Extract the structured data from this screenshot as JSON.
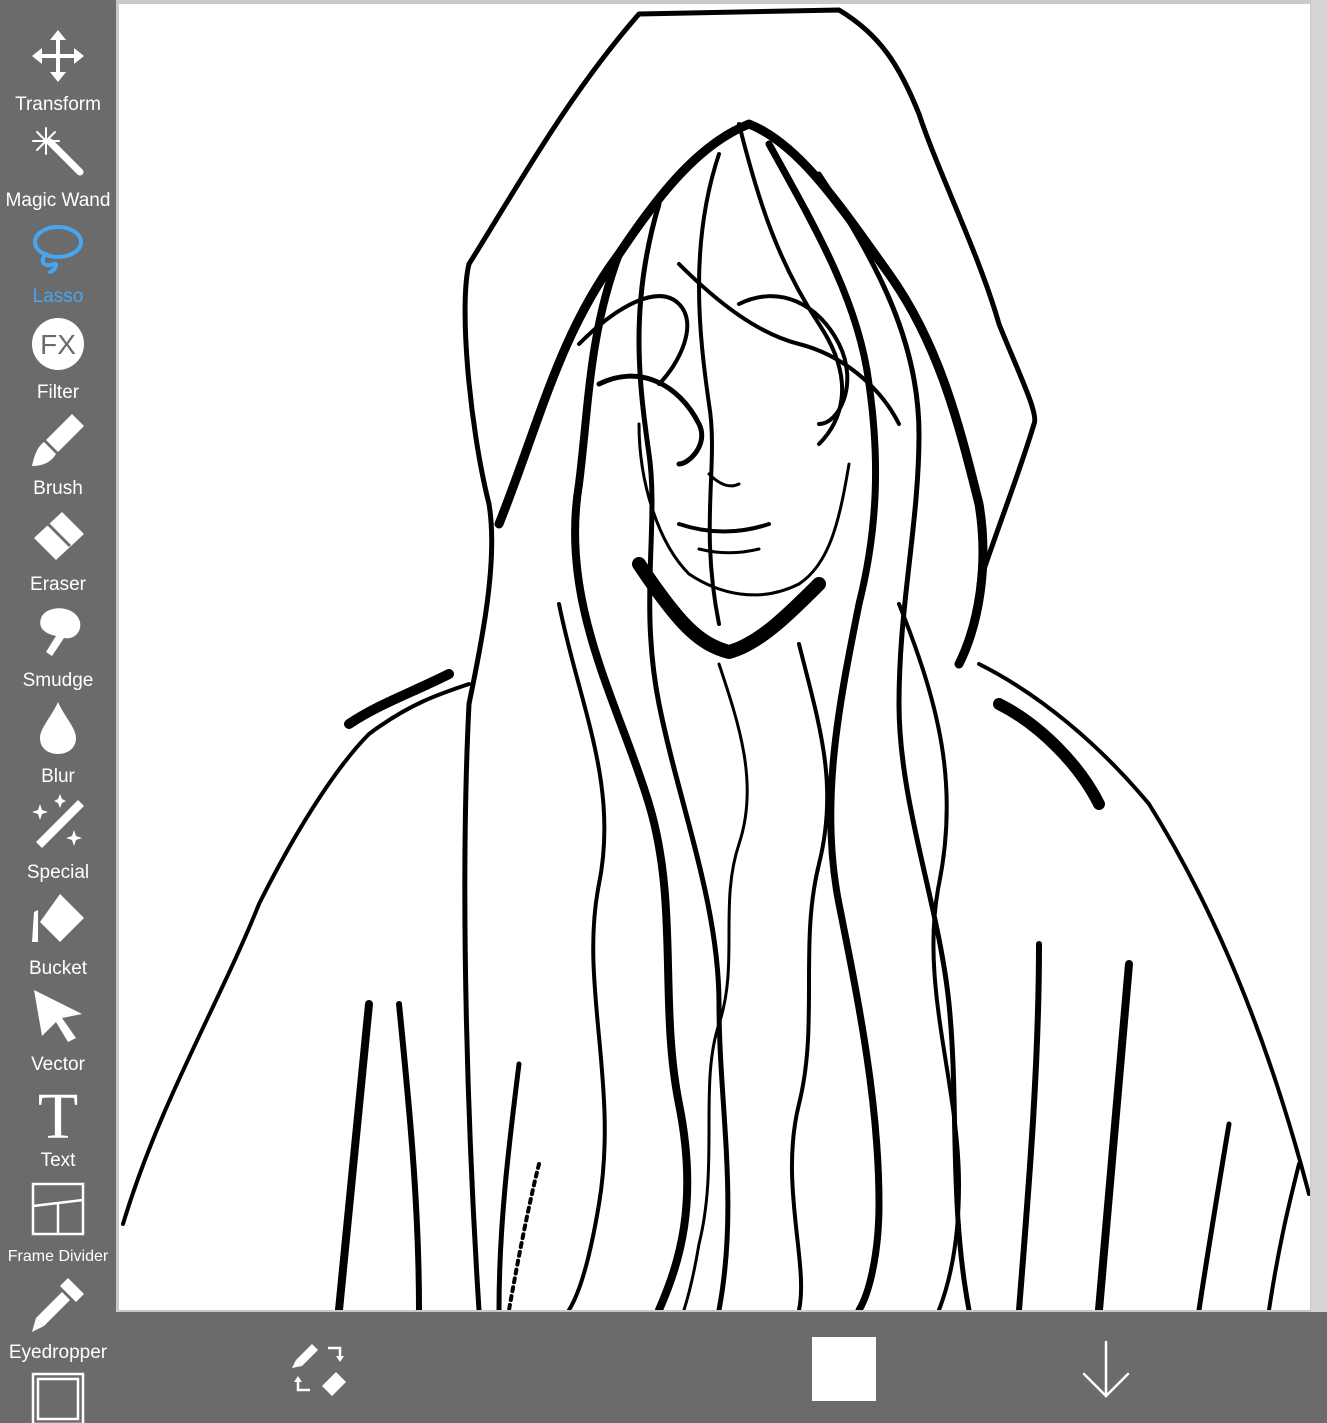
{
  "toolbar": {
    "tools": [
      {
        "label": "Transform",
        "icon": "transform-icon"
      },
      {
        "label": "Magic Wand",
        "icon": "magic-wand-icon"
      },
      {
        "label": "Lasso",
        "icon": "lasso-icon",
        "active": true
      },
      {
        "label": "Filter",
        "icon": "filter-fx-icon",
        "glyph": "FX"
      },
      {
        "label": "Brush",
        "icon": "brush-icon"
      },
      {
        "label": "Eraser",
        "icon": "eraser-icon"
      },
      {
        "label": "Smudge",
        "icon": "smudge-icon"
      },
      {
        "label": "Blur",
        "icon": "blur-drop-icon"
      },
      {
        "label": "Special",
        "icon": "special-sparkle-icon"
      },
      {
        "label": "Bucket",
        "icon": "bucket-icon"
      },
      {
        "label": "Vector",
        "icon": "vector-arrow-icon"
      },
      {
        "label": "Text",
        "icon": "text-icon",
        "glyph": "T"
      },
      {
        "label": "Frame Divider",
        "icon": "frame-divider-icon"
      },
      {
        "label": "Eyedropper",
        "icon": "eyedropper-icon"
      },
      {
        "label": "",
        "icon": "canvas-icon"
      }
    ]
  },
  "canvas": {
    "content": "hooded-figure-line-drawing"
  },
  "bottombar": {
    "swap_icon": "brush-eraser-swap-icon",
    "color": "#ffffff",
    "down_icon": "down-arrow-icon"
  },
  "colors": {
    "panel": "#6b6b6b",
    "active": "#48a6f0",
    "text": "#ffffff"
  }
}
